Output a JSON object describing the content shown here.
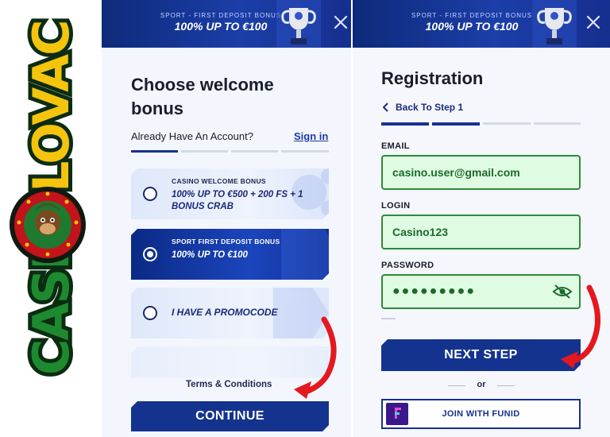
{
  "logo": {
    "brand": "CASINOLOVAC"
  },
  "banner": {
    "subtitle": "SPORT - FIRST DEPOSIT BONUS",
    "headline": "100% UP TO €100"
  },
  "welcome": {
    "title": "Choose welcome bonus",
    "account_prompt": "Already Have An Account?",
    "signin_label": "Sign in",
    "options": [
      {
        "small": "CASINO WELCOME BONUS",
        "big": "100% UP TO €500 + 200 FS + 1 BONUS CRAB",
        "selected": false
      },
      {
        "small": "SPORT FIRST DEPOSIT BONUS",
        "big": "100% UP TO €100",
        "selected": true
      },
      {
        "small": "",
        "big": "I HAVE A PROMOCODE",
        "selected": false
      }
    ],
    "terms_label": "Terms & Conditions",
    "continue_label": "CONTINUE"
  },
  "registration": {
    "title": "Registration",
    "back_label": "Back To Step 1",
    "email_label": "EMAIL",
    "email_value": "casino.user@gmail.com",
    "login_label": "LOGIN",
    "login_value": "Casino123",
    "password_label": "PASSWORD",
    "password_value": "●●●●●●●●●",
    "next_label": "NEXT STEP",
    "or_label": "or",
    "funid_label": "JOIN WITH FUNID"
  },
  "colors": {
    "accent": "#14338f",
    "success": "#2e8a3d",
    "arrow": "#e4191f",
    "logo_green": "#1e8a2f",
    "logo_yellow": "#f5c40d"
  },
  "icons": [
    "close-icon",
    "trophy-icon",
    "chevron-left-icon",
    "eye-off-icon",
    "funid-icon",
    "red-arrow-icon",
    "monkey-mascot-icon"
  ]
}
